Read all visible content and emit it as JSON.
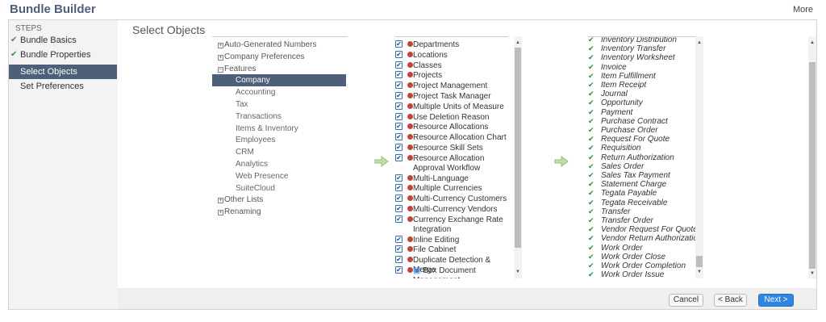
{
  "header": {
    "title": "Bundle Builder",
    "more_label": "More"
  },
  "steps": {
    "heading": "STEPS",
    "items": [
      {
        "label": "Bundle Basics",
        "done": true
      },
      {
        "label": "Bundle Properties",
        "done": true
      },
      {
        "label": "Select Objects",
        "done": false,
        "active": true
      },
      {
        "label": "Set Preferences",
        "done": false
      }
    ]
  },
  "main": {
    "section_title": "Select Objects"
  },
  "tree": {
    "nodes": [
      {
        "label": "Auto-Generated Numbers",
        "exp": "+"
      },
      {
        "label": "Company Preferences",
        "exp": "+"
      },
      {
        "label": "Features",
        "exp": "-"
      },
      {
        "label": "Company",
        "sub": true,
        "selected": true
      },
      {
        "label": "Accounting",
        "sub": true
      },
      {
        "label": "Tax",
        "sub": true
      },
      {
        "label": "Transactions",
        "sub": true
      },
      {
        "label": "Items & Inventory",
        "sub": true
      },
      {
        "label": "Employees",
        "sub": true
      },
      {
        "label": "CRM",
        "sub": true
      },
      {
        "label": "Analytics",
        "sub": true
      },
      {
        "label": "Web Presence",
        "sub": true
      },
      {
        "label": "SuiteCloud",
        "sub": true
      },
      {
        "label": "Other Lists",
        "exp": "+"
      },
      {
        "label": "Renaming",
        "exp": "+"
      }
    ]
  },
  "features_list": [
    {
      "label": "Departments",
      "checked": true
    },
    {
      "label": "Locations",
      "checked": true
    },
    {
      "label": "Classes",
      "checked": true
    },
    {
      "label": "Projects",
      "checked": true
    },
    {
      "label": "Project Management",
      "checked": true
    },
    {
      "label": "Project Task Manager",
      "checked": true
    },
    {
      "label": "Multiple Units of Measure",
      "checked": true
    },
    {
      "label": "Use Deletion Reason",
      "checked": true
    },
    {
      "label": "Resource Allocations",
      "checked": true
    },
    {
      "label": "Resource Allocation Chart",
      "checked": true
    },
    {
      "label": "Resource Skill Sets",
      "checked": true
    },
    {
      "label": "Resource Allocation Approval Workflow",
      "checked": true,
      "lines": 2
    },
    {
      "label": "Multi-Language",
      "checked": true
    },
    {
      "label": "Multiple Currencies",
      "checked": true
    },
    {
      "label": "Multi-Currency Customers",
      "checked": true
    },
    {
      "label": "Multi-Currency Vendors",
      "checked": true
    },
    {
      "label": "Currency Exchange Rate Integration",
      "checked": true,
      "lines": 2
    },
    {
      "label": "Inline Editing",
      "checked": true
    },
    {
      "label": "File Cabinet",
      "checked": true
    },
    {
      "label": "Duplicate Detection & Merge",
      "checked": true
    },
    {
      "label": "Box Document Management",
      "checked": true,
      "lines": 2,
      "box": true
    }
  ],
  "selected_list": [
    "Inventory Distribution",
    "Inventory Transfer",
    "Inventory Worksheet",
    "Invoice",
    "Item Fulfillment",
    "Item Receipt",
    "Journal",
    "Opportunity",
    "Payment",
    "Purchase Contract",
    "Purchase Order",
    "Request For Quote",
    "Requisition",
    "Return Authorization",
    "Sales Order",
    "Sales Tax Payment",
    "Statement Charge",
    "Tegata Payable",
    "Tegata Receivable",
    "Transfer",
    "Transfer Order",
    "Vendor Request For Quote",
    "Vendor Return Authorization",
    "Work Order",
    "Work Order Close",
    "Work Order Completion",
    "Work Order Issue"
  ],
  "buttons": {
    "cancel": "Cancel",
    "back": "< Back",
    "next": "Next >"
  },
  "colors": {
    "accent": "#4d5f79",
    "primary": "#2f85e0"
  },
  "icons": {
    "arrow": "green-right-arrow-icon",
    "check": "checkmark-icon"
  }
}
